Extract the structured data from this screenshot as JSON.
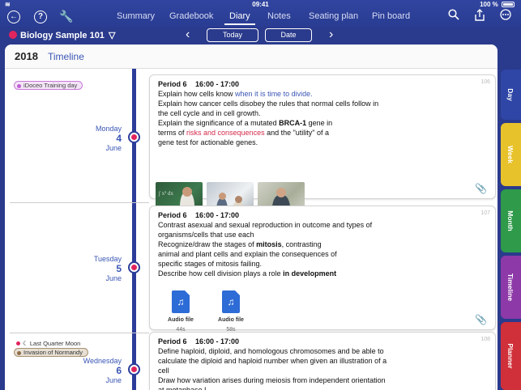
{
  "status": {
    "time": "09:41",
    "battery": "100 %"
  },
  "nav": {
    "tabs": [
      {
        "label": "Summary"
      },
      {
        "label": "Gradebook"
      },
      {
        "label": "Diary"
      },
      {
        "label": "Notes"
      },
      {
        "label": "Seating plan"
      },
      {
        "label": "Pin board"
      }
    ],
    "active_tab": "Diary",
    "back_icon": "back-arrow-icon",
    "help_icon": "help-icon",
    "tools_icon": "wrench-icon",
    "search_icon": "search-icon",
    "share_icon": "share-icon",
    "more_icon": "more-icon"
  },
  "classbar": {
    "class_name": "Biology Sample 101",
    "class_dropdown_glyph": "▽",
    "today_label": "Today",
    "date_label": "Date",
    "class_color": "#e0245e"
  },
  "header": {
    "year": "2018",
    "view_title": "Timeline"
  },
  "days": [
    {
      "weekday": "Monday",
      "day": "4",
      "month": "June",
      "events": [
        {
          "label": "iDoceo Training day",
          "color": "purple"
        }
      ],
      "card": {
        "number": "106",
        "period": "Period 6",
        "time": "16:00 - 17:00",
        "lines": [
          {
            "parts": [
              {
                "t": "Explain how cells know "
              },
              {
                "t": "when it is time to divide.",
                "style": "blue"
              }
            ]
          },
          {
            "parts": [
              {
                "t": "Explain how cancer cells disobey the rules that normal cells follow in"
              }
            ]
          },
          {
            "parts": [
              {
                "t": "the cell cycle and in cell growth."
              }
            ]
          },
          {
            "parts": [
              {
                "t": "Explain the significance of a mutated "
              },
              {
                "t": "BRCA-1",
                "style": "bold"
              },
              {
                "t": " gene in"
              }
            ]
          },
          {
            "parts": [
              {
                "t": "terms of "
              },
              {
                "t": "risks and consequences",
                "style": "red"
              },
              {
                "t": " and the \"utility\" of a"
              }
            ]
          },
          {
            "parts": [
              {
                "t": "gene test for actionable genes."
              }
            ]
          }
        ],
        "images": [
          "teacher-chalkboard-photo",
          "students-lab-photo",
          "teacher-classroom-photo"
        ]
      }
    },
    {
      "weekday": "Tuesday",
      "day": "5",
      "month": "June",
      "events": [],
      "card": {
        "number": "107",
        "period": "Period 6",
        "time": "16:00 - 17:00",
        "lines": [
          {
            "parts": [
              {
                "t": "Contrast asexual and sexual reproduction in outcome and types of"
              }
            ]
          },
          {
            "parts": [
              {
                "t": "organisms/cells that use each"
              }
            ]
          },
          {
            "parts": [
              {
                "t": "Recognize/draw the stages of "
              },
              {
                "t": "mitosis",
                "style": "bold"
              },
              {
                "t": ", contrasting"
              }
            ]
          },
          {
            "parts": [
              {
                "t": "animal and plant cells and explain the consequences of"
              }
            ]
          },
          {
            "parts": [
              {
                "t": "specific stages of mitosis failing."
              }
            ]
          },
          {
            "parts": [
              {
                "t": "Describe how cell division plays a role "
              },
              {
                "t": "in development",
                "style": "bold"
              }
            ]
          }
        ],
        "audio": [
          {
            "label": "Audio file",
            "duration": "44s"
          },
          {
            "label": "Audio file",
            "duration": "58s"
          }
        ]
      }
    },
    {
      "weekday": "Wednesday",
      "day": "6",
      "month": "June",
      "moon": "Last Quarter Moon",
      "events": [
        {
          "label": "Invasion of Normandy",
          "color": "brown"
        }
      ],
      "card": {
        "number": "108",
        "period": "Period 6",
        "time": "16:00 - 17:00",
        "lines": [
          {
            "parts": [
              {
                "t": "Define haploid, diploid, and homologous chromosomes and be able to"
              }
            ]
          },
          {
            "parts": [
              {
                "t": "calculate the diploid and haploid number when given an illustration of a"
              }
            ]
          },
          {
            "parts": [
              {
                "t": "cell"
              }
            ]
          },
          {
            "parts": [
              {
                "t": "Draw how variation arises during meiosis from independent orientation"
              }
            ]
          },
          {
            "parts": [
              {
                "t": "at metaphase I."
              }
            ]
          }
        ]
      }
    }
  ],
  "side_tabs": [
    {
      "label": "Day",
      "color": "#2f46a6"
    },
    {
      "label": "Week",
      "color": "#e8c22a"
    },
    {
      "label": "Month",
      "color": "#2e9a4a"
    },
    {
      "label": "Timeline",
      "color": "#8d3aa8"
    },
    {
      "label": "Planner",
      "color": "#d0303a"
    }
  ]
}
